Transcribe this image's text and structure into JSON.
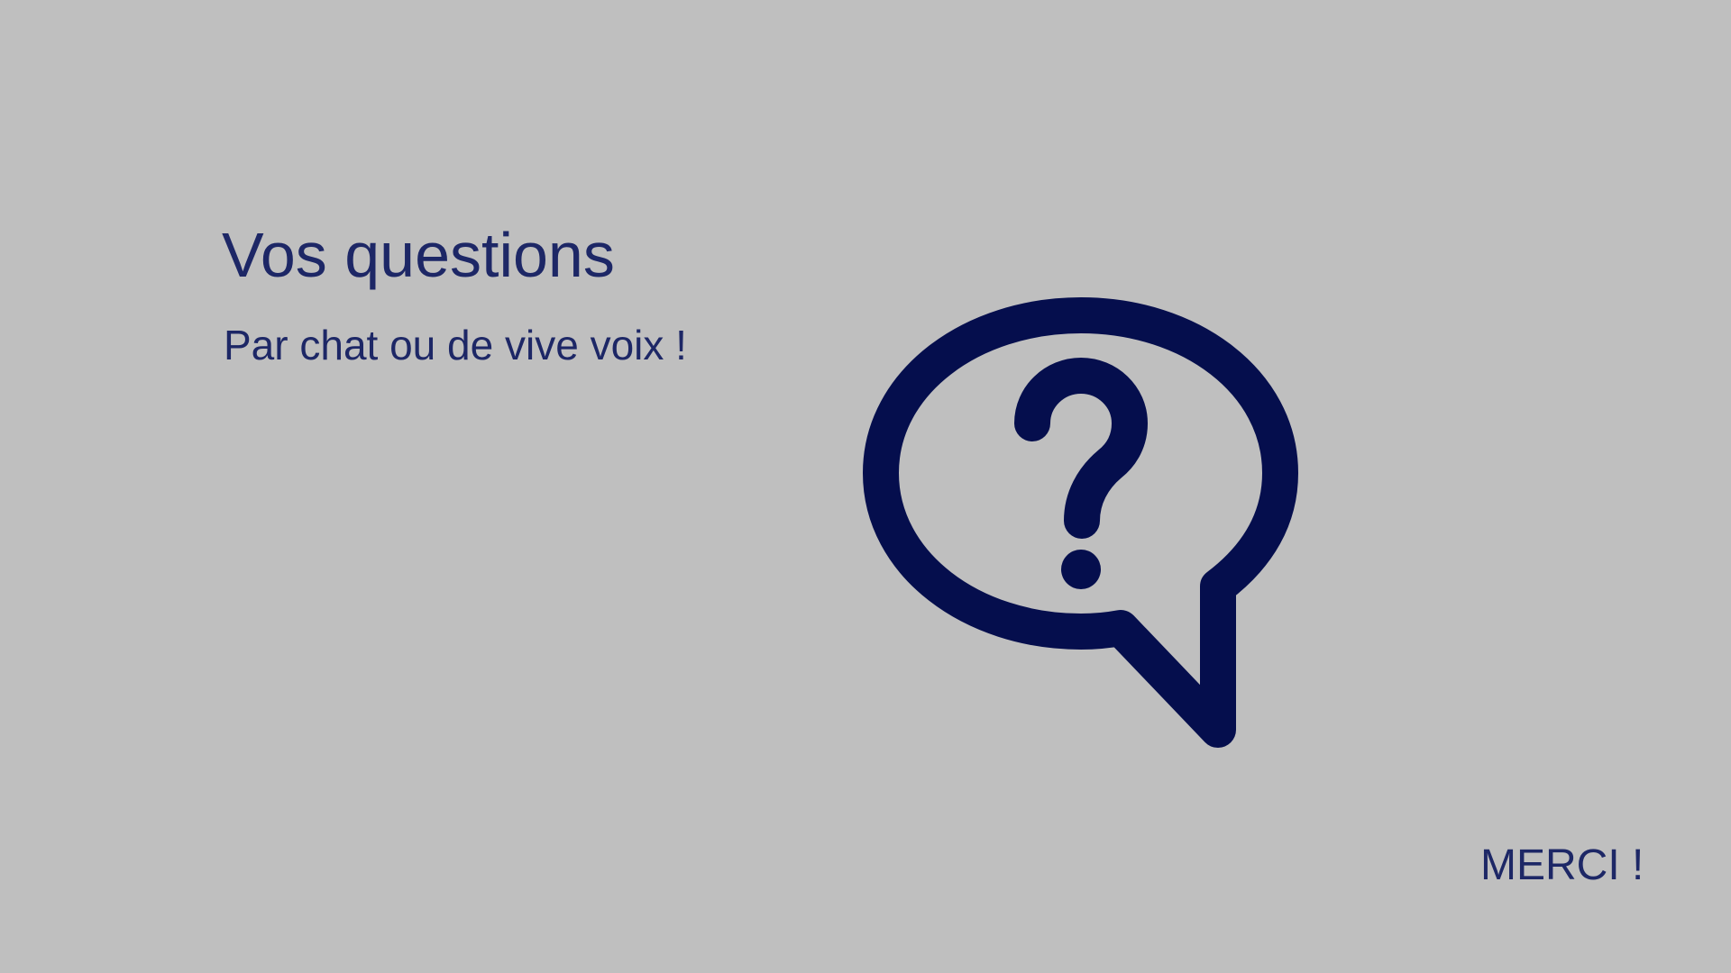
{
  "slide": {
    "title": "Vos questions",
    "subtitle": "Par chat ou de vive voix !",
    "closing": "MERCI !"
  },
  "icon": {
    "name": "question-speech-bubble-icon"
  },
  "colors": {
    "background": "#bfbfbf",
    "text": "#1d2766",
    "icon": "#050e4d"
  }
}
